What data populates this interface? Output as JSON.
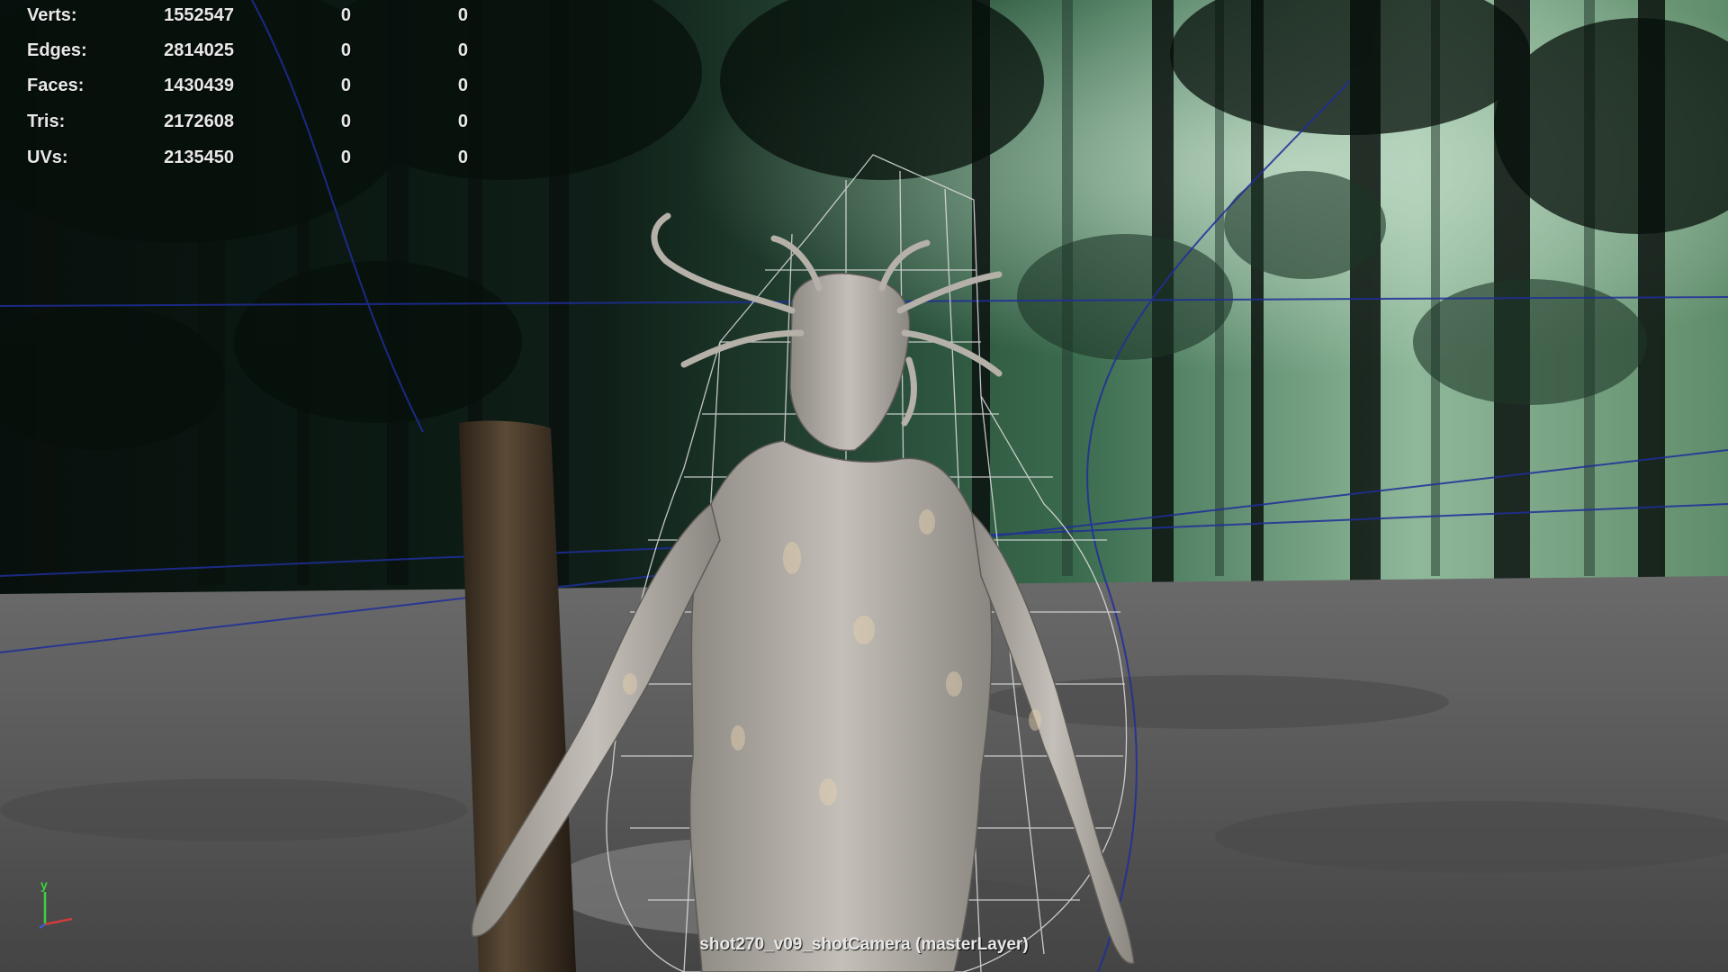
{
  "hud": {
    "rows": [
      {
        "label": "Verts:",
        "total": "1552547",
        "selected": "0",
        "selected2": "0"
      },
      {
        "label": "Edges:",
        "total": "2814025",
        "selected": "0",
        "selected2": "0"
      },
      {
        "label": "Faces:",
        "total": "1430439",
        "selected": "0",
        "selected2": "0"
      },
      {
        "label": "Tris:",
        "total": "2172608",
        "selected": "0",
        "selected2": "0"
      },
      {
        "label": "UVs:",
        "total": "2135450",
        "selected": "0",
        "selected2": "0"
      }
    ]
  },
  "viewport": {
    "camera_label": "shot270_v09_shotCamera (masterLayer)",
    "axis_y_label": "y"
  },
  "colors": {
    "hud_text": "#e8e8e8",
    "forest_fog": "#8fb89a",
    "forest_dark": "#0b130f",
    "ground": "#5c5c5c",
    "creature": "#b9b4ad",
    "wireframe": "#e0e0e0",
    "guide_lines": "#1f2e9a",
    "axis_y": "#3cd23c",
    "axis_x": "#d23c3c",
    "axis_z": "#3c5ad2"
  }
}
